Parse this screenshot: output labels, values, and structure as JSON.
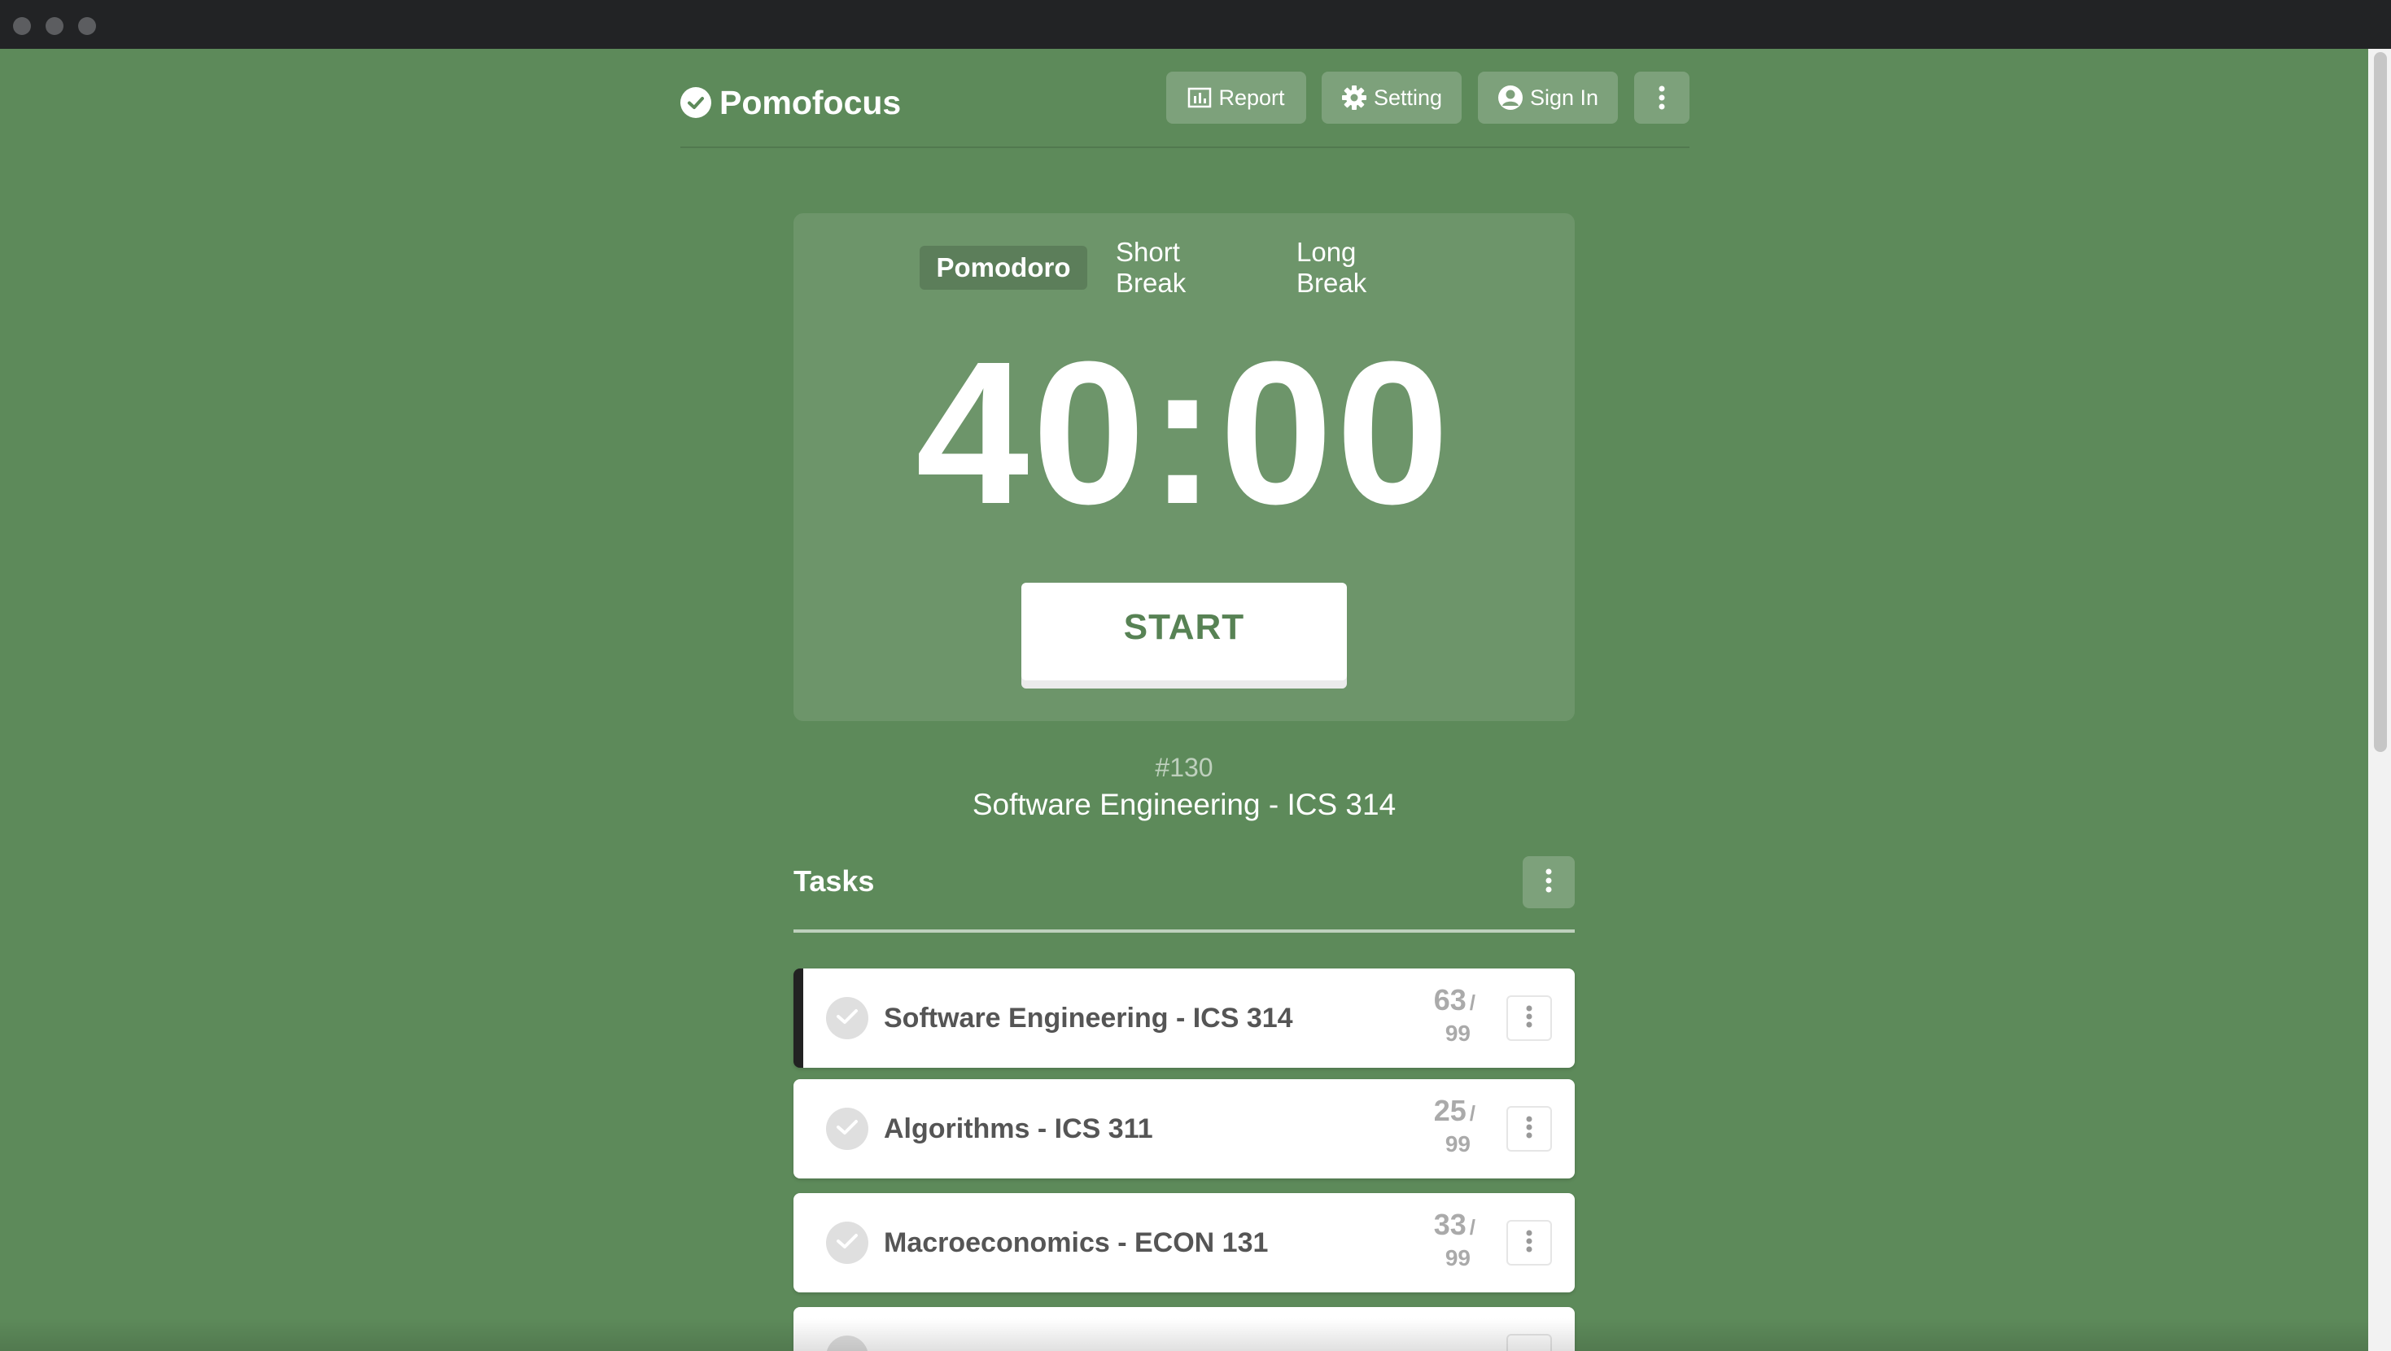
{
  "app": {
    "name": "Pomofocus"
  },
  "header": {
    "report_label": "Report",
    "setting_label": "Setting",
    "signin_label": "Sign In"
  },
  "timer": {
    "modes": [
      "Pomodoro",
      "Short Break",
      "Long Break"
    ],
    "active_mode": "Pomodoro",
    "time": "40:00",
    "start_label": "START"
  },
  "current": {
    "number": "#130",
    "task": "Software Engineering - ICS 314"
  },
  "tasks": {
    "title": "Tasks",
    "items": [
      {
        "name": "Software Engineering - ICS 314",
        "done": "63",
        "total": "99",
        "selected": true
      },
      {
        "name": "Algorithms - ICS 311",
        "done": "25",
        "total": "99",
        "selected": false
      },
      {
        "name": "Macroeconomics - ECON 131",
        "done": "33",
        "total": "99",
        "selected": false
      }
    ]
  },
  "colors": {
    "background": "#5d8a5a",
    "accent": "#578254"
  }
}
